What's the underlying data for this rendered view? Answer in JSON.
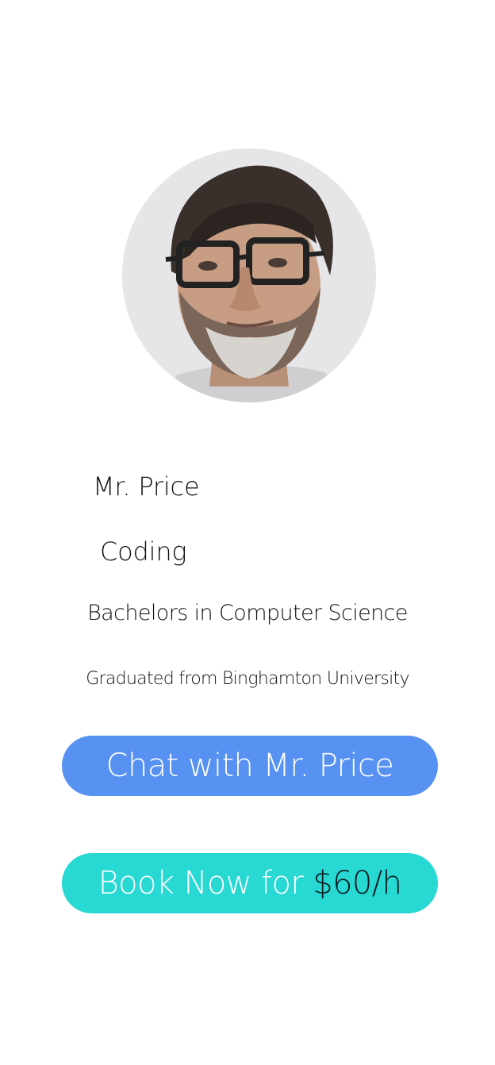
{
  "tutor": {
    "name": "Mr. Price",
    "subject": "Coding",
    "degree": "Bachelors in Computer Science",
    "school": "Graduated from Binghamton University"
  },
  "actions": {
    "chat_label": "Chat with Mr. Price",
    "book_label": "Book Now for",
    "book_price": "$60/h"
  },
  "colors": {
    "chat_button": "#5791f2",
    "book_button": "#27d8d3",
    "background": "#ffffff"
  },
  "icons": {
    "avatar": "profile-photo"
  }
}
